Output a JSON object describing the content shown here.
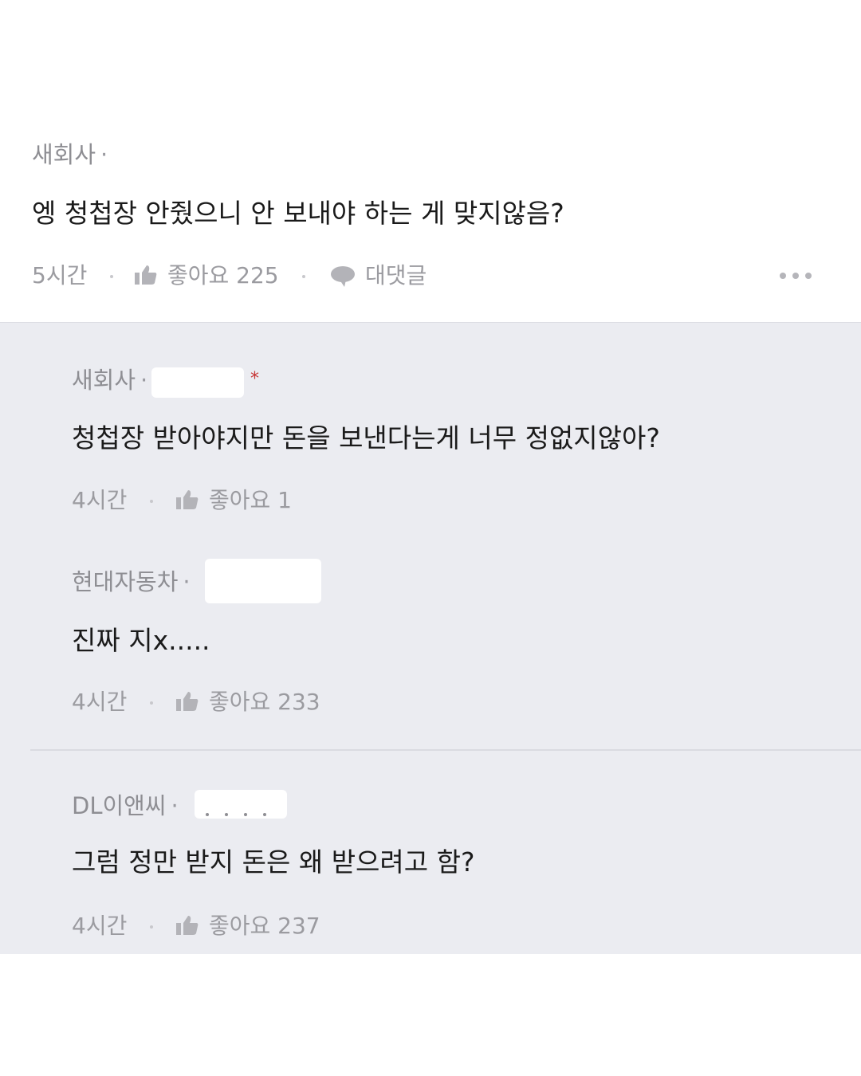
{
  "main_comment": {
    "author": "새회사",
    "separator": "·",
    "text": "엥 청첩장 안줬으니 안 보내야 하는 게 맞지않음?",
    "time": "5시간",
    "like_label": "좋아요 225",
    "reply_label": "대댓글"
  },
  "replies": [
    {
      "author": "새회사",
      "separator": "·",
      "text": "청첩장 받아야지만 돈을 보낸다는게 너무 정없지않아?",
      "time": "4시간",
      "like_label": "좋아요 1",
      "marker": "*"
    },
    {
      "author": "현대자동차",
      "separator": "·",
      "text": "진짜 지x.....",
      "time": "4시간",
      "like_label": "좋아요 233"
    },
    {
      "author": "DL이앤씨",
      "separator": "·",
      "text": "그럼 정만 받지 돈은 왜 받으려고 함?",
      "time": "4시간",
      "like_label": "좋아요 237"
    }
  ],
  "icons": {
    "like": "thumbs-up-icon",
    "reply": "speech-bubble-icon",
    "more": "more-dots-icon"
  },
  "colors": {
    "reply_background": "#ebecf1",
    "meta_text": "#9b9ba0",
    "body_text": "#1a1a1a",
    "marker": "#c73535"
  }
}
